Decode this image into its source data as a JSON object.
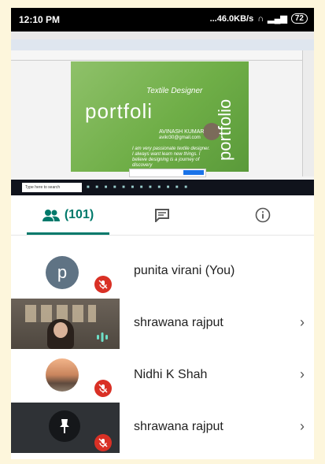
{
  "status_bar": {
    "time": "12:10 PM",
    "net_speed": "...46.0KB/s",
    "battery": "72"
  },
  "shared_screen": {
    "slide": {
      "subtitle": "Textile Designer",
      "title": "portfoli",
      "vertical_text": "portfolio",
      "name": "AVINASH KUMAR",
      "email": "avikr30@gmail.com",
      "quote": "I am very passionate textile designer. I always want learn new things. I believe designing is a journey of discovery"
    },
    "taskbar_search": "Type here to search"
  },
  "tabs": {
    "people_label": "(101)",
    "active": "people"
  },
  "participants": [
    {
      "name": "punita virani (You)",
      "initial": "p",
      "muted": true,
      "has_chevron": false
    },
    {
      "name": "shrawana rajput",
      "muted": false,
      "speaking": true,
      "has_chevron": true
    },
    {
      "name": "Nidhi K Shah",
      "muted": true,
      "has_chevron": true
    },
    {
      "name": "shrawana rajput",
      "muted": true,
      "has_chevron": true
    }
  ],
  "colors": {
    "accent": "#00796b",
    "mute_red": "#d93025",
    "slide_green": "#6fae47"
  }
}
